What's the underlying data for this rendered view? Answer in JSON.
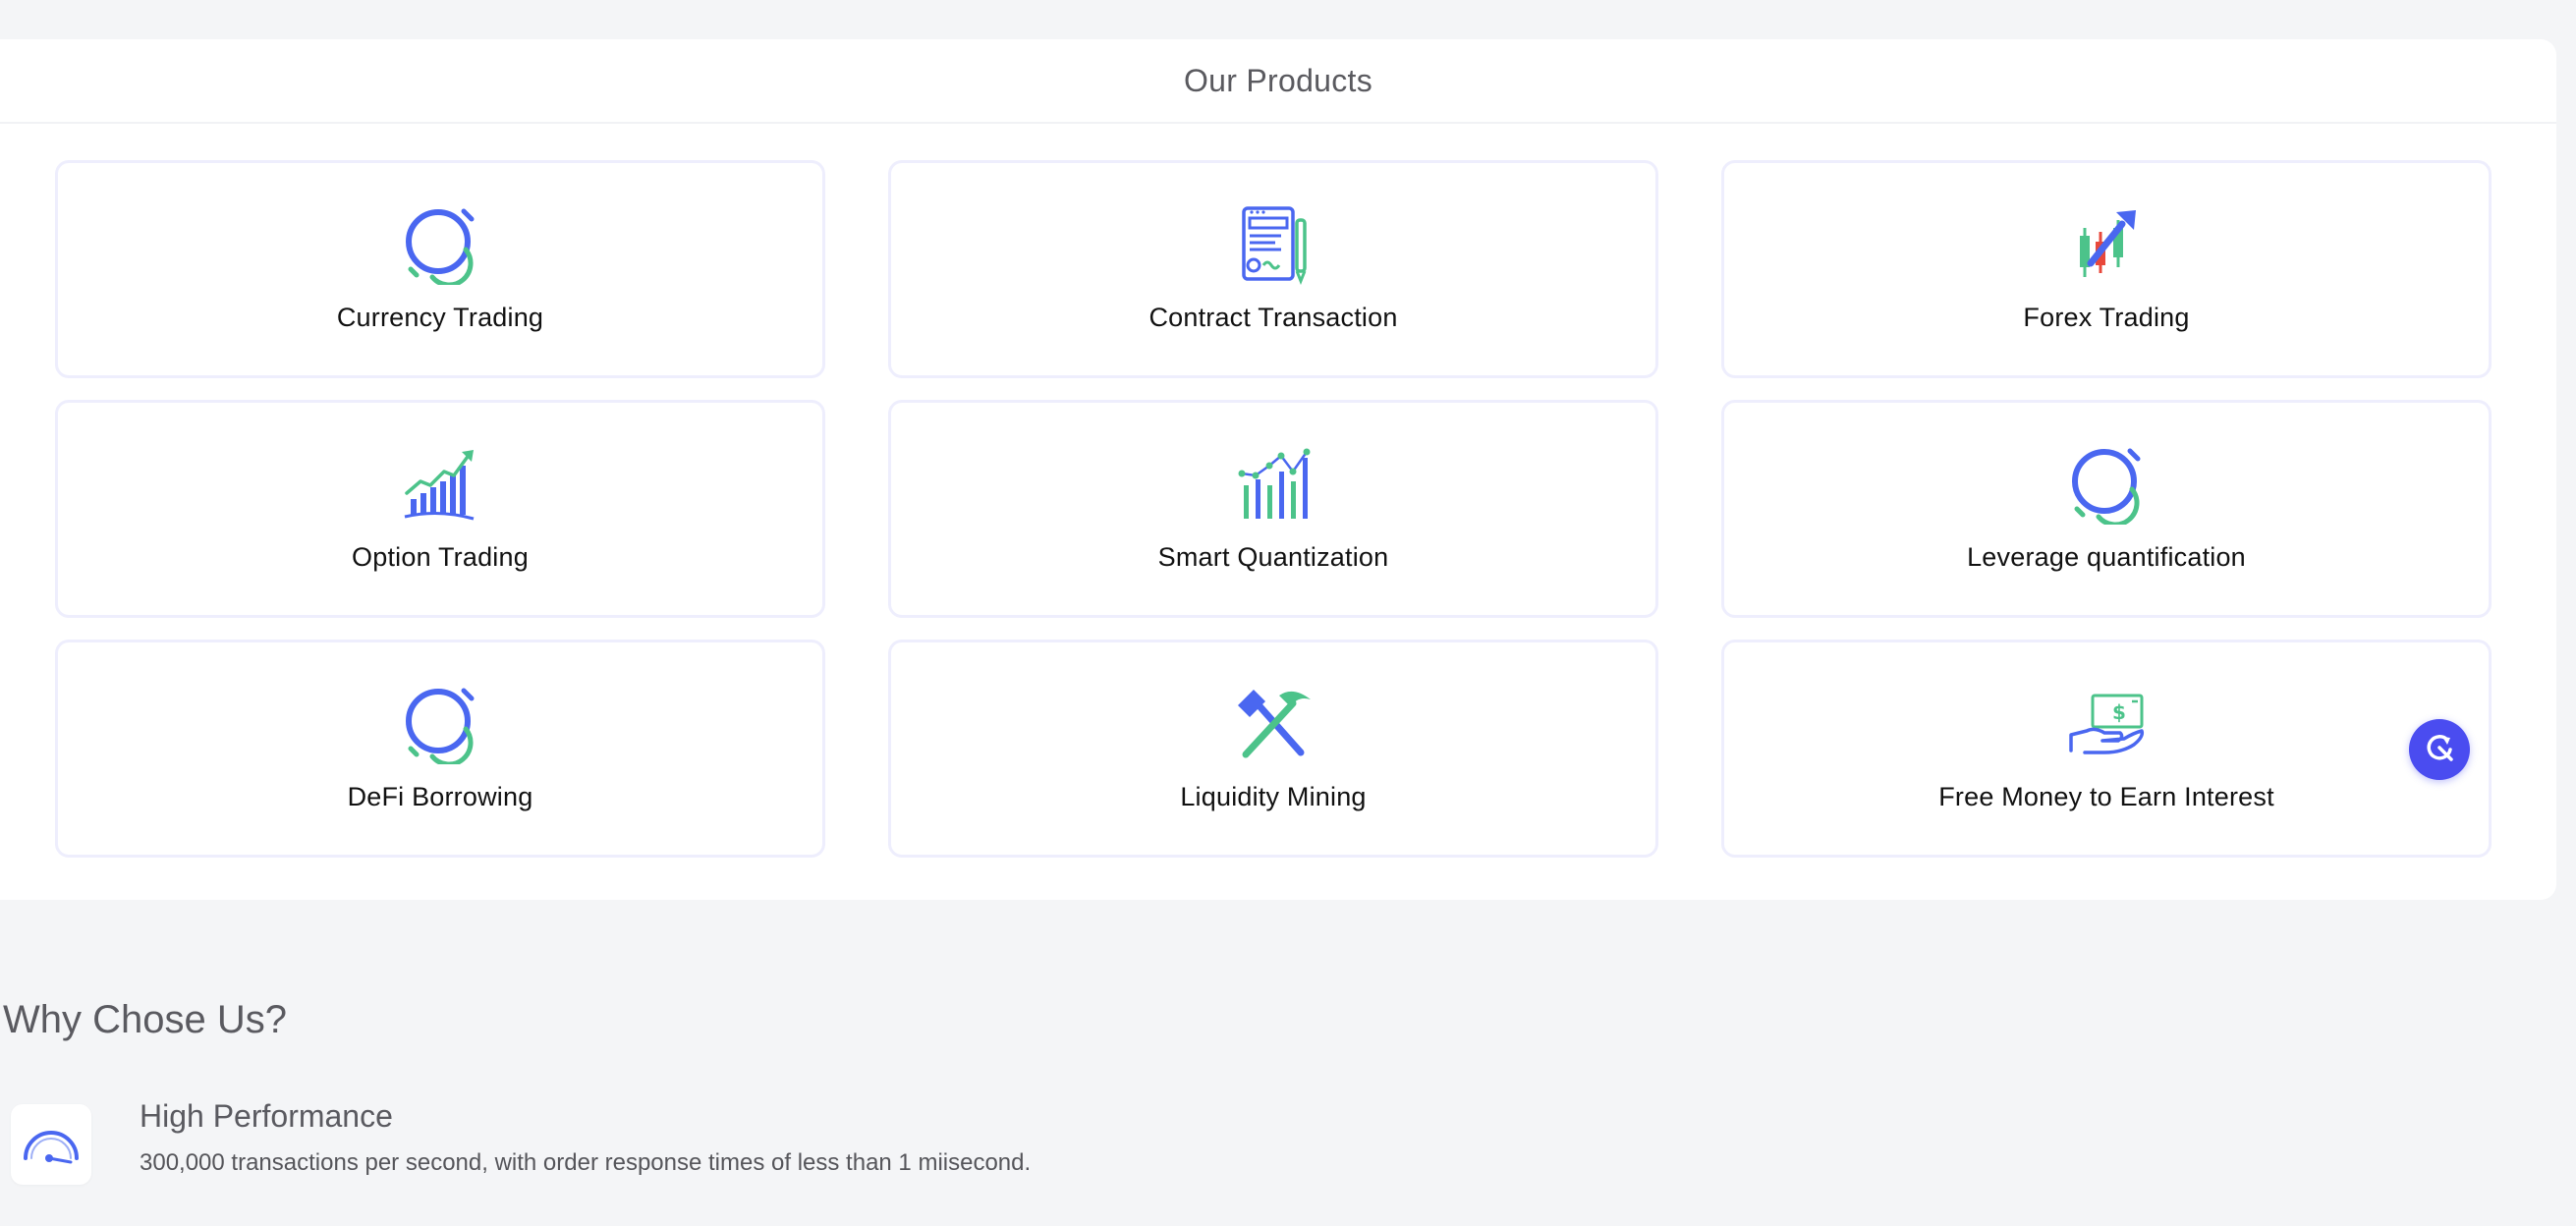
{
  "products": {
    "title": "Our Products",
    "items": [
      {
        "label": "Currency Trading",
        "icon": "currency-trading-icon"
      },
      {
        "label": "Contract Transaction",
        "icon": "contract-document-icon"
      },
      {
        "label": "Forex Trading",
        "icon": "candlestick-chart-icon"
      },
      {
        "label": "Option Trading",
        "icon": "rising-bar-chart-icon"
      },
      {
        "label": "Smart Quantization",
        "icon": "line-bar-chart-icon"
      },
      {
        "label": "Leverage quantification",
        "icon": "leverage-icon"
      },
      {
        "label": "DeFi Borrowing",
        "icon": "defi-borrowing-icon"
      },
      {
        "label": "Liquidity Mining",
        "icon": "pickaxe-hammer-icon"
      },
      {
        "label": "Free Money to Earn Interest",
        "icon": "hand-money-icon"
      }
    ]
  },
  "why": {
    "title": "Why Chose Us?",
    "features": [
      {
        "title": "High Performance",
        "description": "300,000 transactions per second, with order response times of less than 1 miisecond.",
        "icon": "speedometer-icon"
      }
    ]
  },
  "colors": {
    "accent_blue": "#4a67f0",
    "accent_green": "#4cc38a",
    "accent_red": "#e8483b",
    "float_button": "#4a4cf0"
  }
}
